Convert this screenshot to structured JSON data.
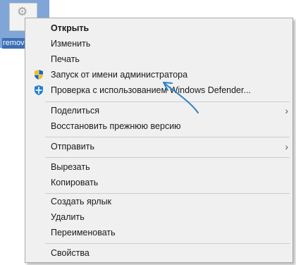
{
  "desktop_file": {
    "label": "remov"
  },
  "menu": {
    "items": [
      {
        "label": "Открыть",
        "default": true
      },
      {
        "label": "Изменить"
      },
      {
        "label": "Печать"
      },
      {
        "label": "Запуск от имени администратора",
        "icon": "uac-shield-icon"
      },
      {
        "label": "Проверка с использованием Windows Defender...",
        "icon": "windows-defender-icon"
      },
      {
        "label": "Поделиться",
        "submenu": true
      },
      {
        "label": "Восстановить прежнюю версию"
      },
      {
        "label": "Отправить",
        "submenu": true
      },
      {
        "label": "Вырезать"
      },
      {
        "label": "Копировать"
      },
      {
        "label": "Создать ярлык"
      },
      {
        "label": "Удалить"
      },
      {
        "label": "Переименовать"
      },
      {
        "label": "Свойства"
      }
    ],
    "submenu_arrow": "›"
  },
  "colors": {
    "menu_bg": "#f0f0f0",
    "annotation_arrow": "#2e82c8",
    "selection_bg": "#3d6fb5"
  }
}
